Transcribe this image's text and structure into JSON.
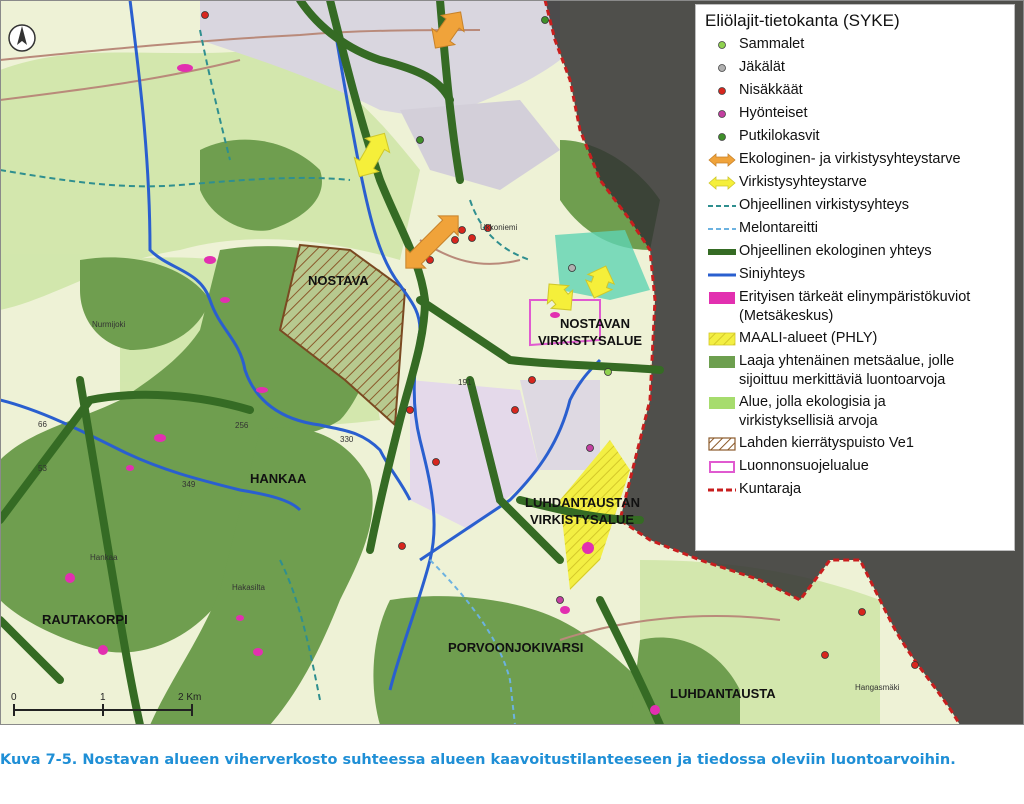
{
  "legend": {
    "title": "Eliölajit-tietokanta (SYKE)",
    "items": [
      {
        "label": "Sammalet",
        "icon": "green-dot-icon",
        "color": "#8fd14f"
      },
      {
        "label": "Jäkälät",
        "icon": "grey-dot-icon",
        "color": "#b0b0b0"
      },
      {
        "label": "Nisäkkäät",
        "icon": "red-dot-icon",
        "color": "#d7261e"
      },
      {
        "label": "Hyönteiset",
        "icon": "magenta-dot-icon",
        "color": "#c23fa0"
      },
      {
        "label": "Putkilokasvit",
        "icon": "dark-green-dot-icon",
        "color": "#3f8f2a"
      },
      {
        "label": "Ekologinen- ja virkistysyhteystarve",
        "icon": "orange-double-arrow-icon",
        "color": "#f0a33a"
      },
      {
        "label": "Virkistysyhteystarve",
        "icon": "yellow-double-arrow-icon",
        "color": "#f5ef3a"
      },
      {
        "label": "Ohjeellinen virkistysyhteys",
        "icon": "teal-dashed-line-icon",
        "color": "#2f8f8f"
      },
      {
        "label": "Melontareitti",
        "icon": "lightblue-dashed-line-icon",
        "color": "#6cb2e0"
      },
      {
        "label": "Ohjeellinen ekologinen yhteys",
        "icon": "green-thick-line-icon",
        "color": "#356b24"
      },
      {
        "label": "Siniyhteys",
        "icon": "blue-line-icon",
        "color": "#2a5fcf"
      },
      {
        "label": "Erityisen tärkeät elinympäristökuviot",
        "label2": "(Metsäkeskus)",
        "icon": "magenta-patch-icon",
        "color": "#e230b0"
      },
      {
        "label": "MAALI-alueet (PHLY)",
        "icon": "yellow-hatched-patch-icon",
        "color": "#f3ef43"
      },
      {
        "label": "Laaja yhtenäinen metsäalue, jolle",
        "label2": "sijoittuu merkittäviä luontoarvoja",
        "icon": "forest-green-patch-icon",
        "color": "#6d9f4f"
      },
      {
        "label": "Alue, jolla ekologisia ja",
        "label2": "virkistyksellisiä arvoja",
        "icon": "light-green-patch-icon",
        "color": "#a6dc6d"
      },
      {
        "label": "Lahden kierrätyspuisto Ve1",
        "icon": "brown-hatched-patch-icon",
        "color": "#8b5a2b"
      },
      {
        "label": "Luonnonsuojelualue",
        "icon": "pink-outline-patch-icon",
        "color": "#e05ad0"
      },
      {
        "label": "Kuntaraja",
        "icon": "red-dashed-line-icon",
        "color": "#c81e1e"
      }
    ]
  },
  "map": {
    "labels": {
      "nostava": "NOSTAVA",
      "nostavan_1": "NOSTAVAN",
      "nostavan_2": "VIRKISTYSALUE",
      "hankaa": "HANKAA",
      "luhdantaustan_1": "LUHDANTAUSTAN",
      "luhdantaustan_2": "VIRKISTYSALUE",
      "rautakorpi": "RAUTAKORPI",
      "porvoonjokivarsi": "PORVOONJOKIVARSI",
      "luhdantausta": "LUHDANTAUSTA"
    },
    "small_labels": {
      "ukkoniemi": "Ukkoniemi",
      "nurmijoki": "Nurmijoki",
      "hankaa_small": "Hankaa",
      "hakasilta": "Hakasilta",
      "hangasmaki": "Hangasmäki",
      "n256": "256",
      "n330": "330",
      "n349": "349",
      "n191": "191",
      "n53": "53",
      "n66": "66"
    }
  },
  "scale": {
    "zero": "0",
    "one": "1",
    "two": "2 Km"
  },
  "caption": "Kuva 7-5.  Nostavan alueen viherverkosto suhteessa alueen kaavoitustilanteeseen ja tiedossa oleviin luontoarvoihin."
}
